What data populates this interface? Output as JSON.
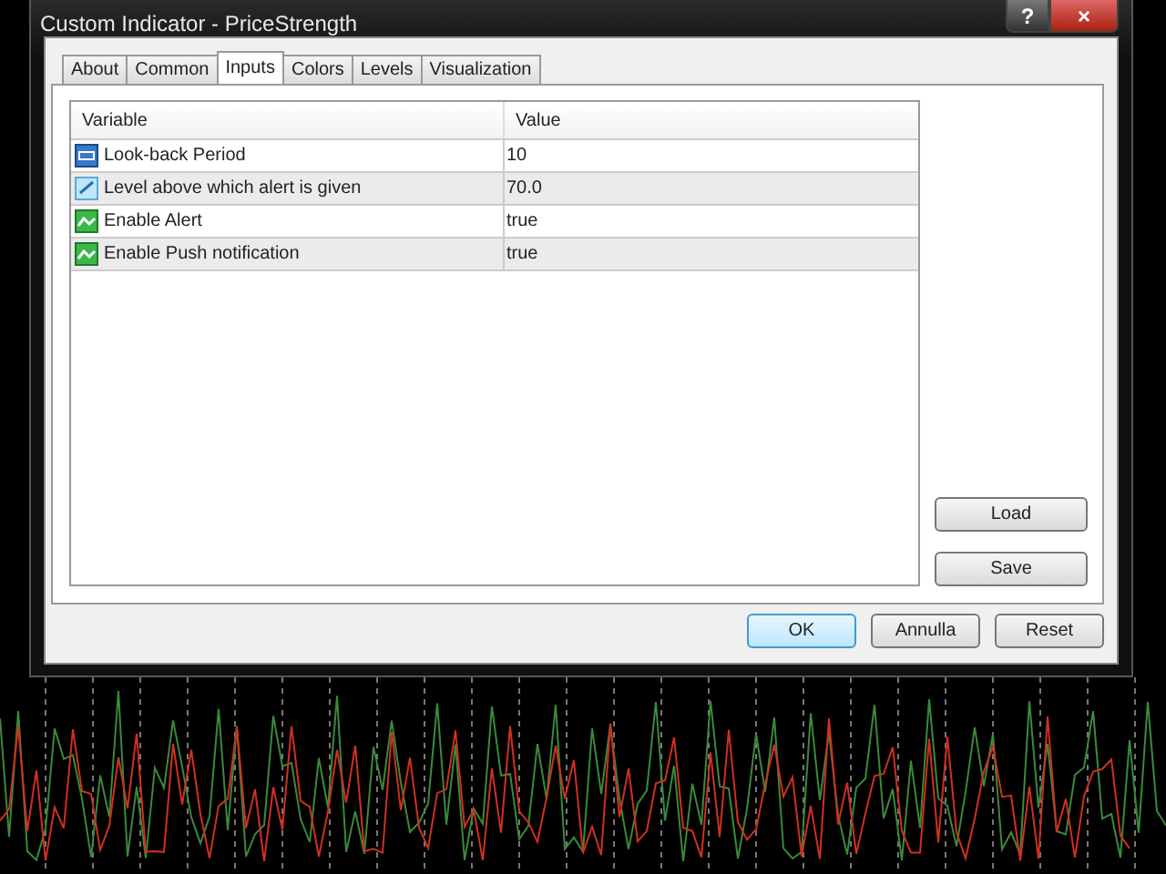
{
  "window": {
    "title": "Custom Indicator - PriceStrength",
    "buttons": [
      "?",
      "×"
    ]
  },
  "tabs": [
    {
      "label": "About",
      "selected": false
    },
    {
      "label": "Common",
      "selected": false
    },
    {
      "label": "Inputs",
      "selected": true
    },
    {
      "label": "Colors",
      "selected": false
    },
    {
      "label": "Levels",
      "selected": false
    },
    {
      "label": "Visualization",
      "selected": false
    }
  ],
  "table": {
    "columns": [
      "Variable",
      "Value"
    ],
    "rows": [
      {
        "kind": "integer",
        "variable": "Look-back Period",
        "value": "10"
      },
      {
        "kind": "double",
        "variable": "Level above which alert is given",
        "value": "70.0"
      },
      {
        "kind": "bool",
        "variable": "Enable Alert",
        "value": "true"
      },
      {
        "kind": "bool",
        "variable": "Enable Push notification",
        "value": "true"
      }
    ]
  },
  "side_buttons": [
    "Load",
    "Save"
  ],
  "footer_buttons": [
    {
      "label": "OK",
      "default": true
    },
    {
      "label": "Annulla",
      "default": false
    },
    {
      "label": "Reset",
      "default": false
    }
  ]
}
